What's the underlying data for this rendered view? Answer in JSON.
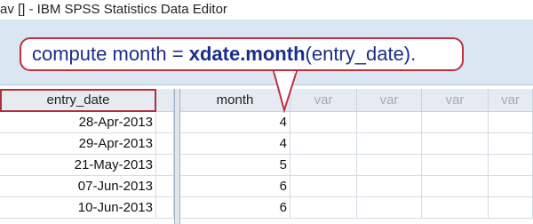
{
  "window": {
    "title": "av [] - IBM SPSS Statistics Data Editor"
  },
  "callout": {
    "prefix": "compute month = ",
    "function": "xdate.month",
    "suffix": "(entry_date)."
  },
  "columns": {
    "entry_date": "entry_date",
    "month": "month",
    "var1": "var",
    "var2": "var",
    "var3": "var",
    "var4": "var"
  },
  "rows": [
    {
      "entry_date": "28-Apr-2013",
      "month": "4"
    },
    {
      "entry_date": "29-Apr-2013",
      "month": "4"
    },
    {
      "entry_date": "21-May-2013",
      "month": "5"
    },
    {
      "entry_date": "07-Jun-2013",
      "month": "6"
    },
    {
      "entry_date": "10-Jun-2013",
      "month": "6"
    }
  ],
  "colors": {
    "callout_border": "#c0303c",
    "callout_text": "#1b2d8a",
    "header_bg": "#e6ebf2"
  }
}
